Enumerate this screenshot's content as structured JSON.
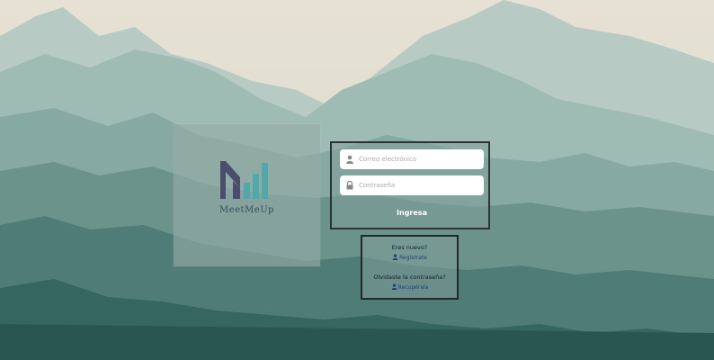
{
  "brand": {
    "name": "MeetMeUp"
  },
  "login": {
    "email_placeholder": "Correo electrónico",
    "password_placeholder": "Contraseña",
    "submit_label": "Ingresa"
  },
  "register": {
    "new_question": "Eres nuevo?",
    "register_link": "Regístrate",
    "forgot_question": "Olvidaste la contraseña?",
    "recover_link": "Recupérala"
  },
  "icons": {
    "user": "user-icon",
    "lock": "lock-icon",
    "link_user": "user-icon"
  },
  "colors": {
    "sky": "#e3ded1",
    "mountain_light": "#9dbab2",
    "mountain_dark": "#2d5a56",
    "logo_dark": "#4b4d6e",
    "logo_teal": "#4fa8aa",
    "link": "#1f3f7a"
  }
}
